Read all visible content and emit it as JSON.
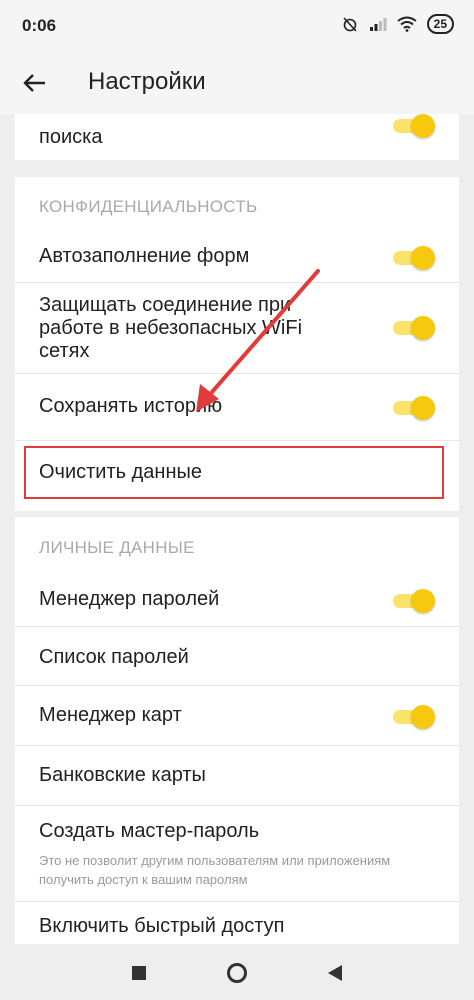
{
  "status_bar": {
    "time": "0:06",
    "battery": "25"
  },
  "app_bar": {
    "title": "Настройки"
  },
  "partial_item": {
    "label": "поиска"
  },
  "privacy": {
    "header": "КОНФИДЕНЦИАЛЬНОСТЬ",
    "items": [
      {
        "label": "Автозаполнение форм",
        "toggle": true
      },
      {
        "label": "Защищать соединение при работе в небезопасных WiFi сетях",
        "toggle": true
      },
      {
        "label": "Сохранять историю",
        "toggle": true
      },
      {
        "label": "Очистить данные",
        "toggle": null
      }
    ]
  },
  "personal": {
    "header": "ЛИЧНЫЕ ДАННЫЕ",
    "items": [
      {
        "label": "Менеджер паролей",
        "toggle": true
      },
      {
        "label": "Список паролей",
        "toggle": null
      },
      {
        "label": "Менеджер карт",
        "toggle": true
      },
      {
        "label": "Банковские карты",
        "toggle": null
      },
      {
        "label": "Создать мастер-пароль",
        "hint": "Это не позволит другим пользователям или приложениям получить доступ к вашим паролям"
      },
      {
        "label": "Включить быстрый доступ",
        "toggle": null
      }
    ]
  },
  "colors": {
    "accent": "#f6c90e",
    "highlight": "#e03c3c"
  }
}
